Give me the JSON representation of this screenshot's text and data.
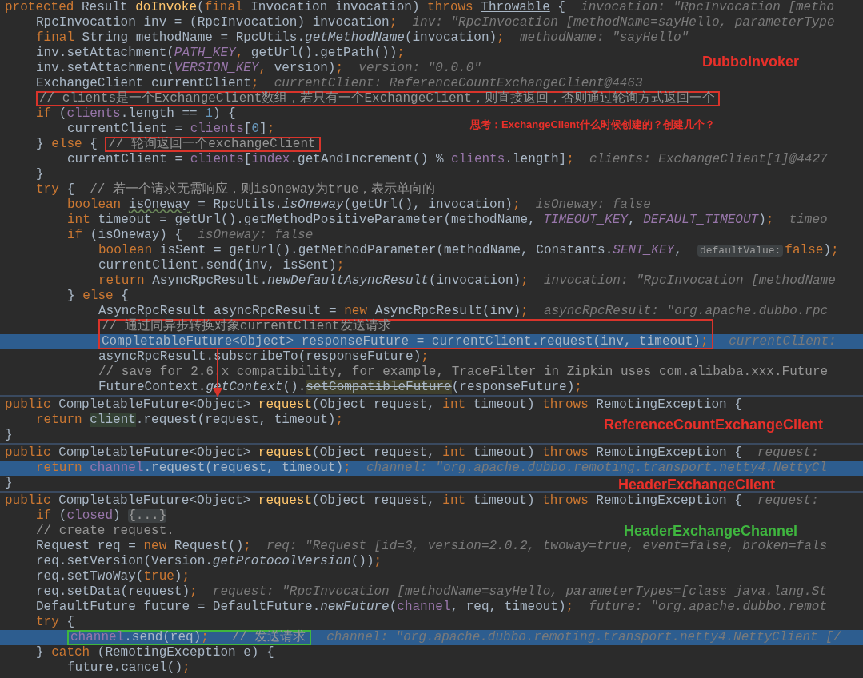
{
  "panels": [
    {
      "label": {
        "text": "DubboInvoker",
        "color": "#e8302a"
      },
      "note": {
        "text": "思考：ExchangeClient什么时候创建的？创建几个？",
        "color": "#e8302a"
      },
      "lines": [
        {
          "kind": "line",
          "highlighted": false,
          "tokens": [
            {
              "kind": "kw",
              "text": "protected "
            },
            {
              "kind": "plain",
              "text": "Result "
            },
            {
              "kind": "decl",
              "text": "doInvoke"
            },
            {
              "kind": "plain",
              "text": "("
            },
            {
              "kind": "kw",
              "text": "final "
            },
            {
              "kind": "plain",
              "text": "Invocation invocation) "
            },
            {
              "kind": "kw",
              "text": "throws "
            },
            {
              "kind": "underlined",
              "text": "Throwable"
            },
            {
              "kind": "plain",
              "text": " {  "
            },
            {
              "kind": "hint",
              "text": "invocation: \"RpcInvocation [metho"
            }
          ],
          "children": [
            {
              "kind": "line",
              "highlighted": false,
              "tokens": [
                {
                  "kind": "plain",
                  "text": "RpcInvocation inv = (RpcInvocation) invocation"
                },
                {
                  "kind": "kw",
                  "text": ";"
                },
                {
                  "kind": "hint",
                  "text": "  inv: \"RpcInvocation [methodName=sayHello, parameterType"
                }
              ]
            },
            {
              "kind": "line",
              "highlighted": false,
              "tokens": [
                {
                  "kind": "kw",
                  "text": "final "
                },
                {
                  "kind": "plain",
                  "text": "String methodName = RpcUtils."
                },
                {
                  "kind": "static",
                  "text": "getMethodName"
                },
                {
                  "kind": "plain",
                  "text": "(invocation)"
                },
                {
                  "kind": "kw",
                  "text": ";"
                },
                {
                  "kind": "hint",
                  "text": "  methodName: \"sayHello\""
                }
              ]
            },
            {
              "kind": "line",
              "highlighted": false,
              "tokens": [
                {
                  "kind": "plain",
                  "text": "inv.setAttachment("
                },
                {
                  "kind": "const",
                  "text": "PATH_KEY"
                },
                {
                  "kind": "kw",
                  "text": ", "
                },
                {
                  "kind": "plain",
                  "text": "getUrl().getPath())"
                },
                {
                  "kind": "kw",
                  "text": ";"
                }
              ]
            },
            {
              "kind": "line",
              "highlighted": false,
              "tokens": [
                {
                  "kind": "plain",
                  "text": "inv.setAttachment("
                },
                {
                  "kind": "const",
                  "text": "VERSION_KEY"
                },
                {
                  "kind": "kw",
                  "text": ", "
                },
                {
                  "kind": "plain",
                  "text": "version)"
                },
                {
                  "kind": "kw",
                  "text": ";"
                },
                {
                  "kind": "hint",
                  "text": "  version: \"0.0.0\""
                }
              ]
            },
            {
              "kind": "line",
              "highlighted": false,
              "tokens": [
                {
                  "kind": "plain",
                  "text": "ExchangeClient currentClient"
                },
                {
                  "kind": "kw",
                  "text": ";"
                },
                {
                  "kind": "hint",
                  "text": "  currentClient: ReferenceCountExchangeClient@4463"
                }
              ]
            },
            {
              "kind": "box",
              "color": "#d9342b",
              "lines": [
                {
                  "highlighted": false,
                  "inside": [
                    {
                      "kind": "comment",
                      "text": "// clients是一个ExchangeClient数组，若只有一个ExchangeClient，则直接返回，否则通过轮询方式返回一个"
                    }
                  ]
                }
              ]
            },
            {
              "kind": "line",
              "highlighted": false,
              "tokens": [
                {
                  "kind": "kw",
                  "text": "if "
                },
                {
                  "kind": "plain",
                  "text": "("
                },
                {
                  "kind": "field",
                  "text": "clients"
                },
                {
                  "kind": "plain",
                  "text": ".length == "
                },
                {
                  "kind": "num",
                  "text": "1"
                },
                {
                  "kind": "plain",
                  "text": ") {"
                }
              ],
              "children": [
                {
                  "kind": "line",
                  "highlighted": false,
                  "tokens": [
                    {
                      "kind": "plain",
                      "text": "currentClient = "
                    },
                    {
                      "kind": "field",
                      "text": "clients"
                    },
                    {
                      "kind": "plain",
                      "text": "["
                    },
                    {
                      "kind": "num",
                      "text": "0"
                    },
                    {
                      "kind": "plain",
                      "text": "]"
                    },
                    {
                      "kind": "kw",
                      "text": ";"
                    }
                  ]
                }
              ]
            },
            {
              "kind": "box",
              "color": "#d9342b",
              "lines": [
                {
                  "highlighted": false,
                  "before": [
                    {
                      "kind": "plain",
                      "text": "} "
                    },
                    {
                      "kind": "kw",
                      "text": "else "
                    },
                    {
                      "kind": "plain",
                      "text": "{ "
                    }
                  ],
                  "inside": [
                    {
                      "kind": "comment",
                      "text": "// 轮询返回一个exchangeClient"
                    }
                  ]
                }
              ],
              "children": [
                {
                  "kind": "line",
                  "highlighted": false,
                  "tokens": [
                    {
                      "kind": "plain",
                      "text": "currentClient = "
                    },
                    {
                      "kind": "field",
                      "text": "clients"
                    },
                    {
                      "kind": "plain",
                      "text": "["
                    },
                    {
                      "kind": "field",
                      "text": "index"
                    },
                    {
                      "kind": "plain",
                      "text": ".getAndIncrement() % "
                    },
                    {
                      "kind": "field",
                      "text": "clients"
                    },
                    {
                      "kind": "plain",
                      "text": ".length]"
                    },
                    {
                      "kind": "kw",
                      "text": ";"
                    },
                    {
                      "kind": "hint",
                      "text": "  clients: ExchangeClient[1]@4427"
                    }
                  ]
                }
              ]
            },
            {
              "kind": "line",
              "highlighted": false,
              "tokens": [
                {
                  "kind": "plain",
                  "text": "}"
                }
              ]
            },
            {
              "kind": "line",
              "highlighted": false,
              "tokens": [
                {
                  "kind": "kw",
                  "text": "try "
                },
                {
                  "kind": "plain",
                  "text": "{  "
                },
                {
                  "kind": "comment",
                  "text": "// 若一个请求无需响应，则isOneway为true，表示单向的"
                }
              ],
              "children": [
                {
                  "kind": "line",
                  "highlighted": false,
                  "tokens": [
                    {
                      "kind": "kw",
                      "text": "boolean "
                    },
                    {
                      "kind": "typo",
                      "text": "isOneway"
                    },
                    {
                      "kind": "plain",
                      "text": " = RpcUtils."
                    },
                    {
                      "kind": "static",
                      "text": "isOneway"
                    },
                    {
                      "kind": "plain",
                      "text": "(getUrl(), invocation)"
                    },
                    {
                      "kind": "kw",
                      "text": ";"
                    },
                    {
                      "kind": "hint",
                      "text": "  isOneway: false"
                    }
                  ]
                },
                {
                  "kind": "line",
                  "highlighted": false,
                  "tokens": [
                    {
                      "kind": "kw",
                      "text": "int "
                    },
                    {
                      "kind": "plain",
                      "text": "timeout = getUrl().getMethodPositiveParameter(methodName, "
                    },
                    {
                      "kind": "const",
                      "text": "TIMEOUT_KEY"
                    },
                    {
                      "kind": "plain",
                      "text": ", "
                    },
                    {
                      "kind": "const",
                      "text": "DEFAULT_TIMEOUT"
                    },
                    {
                      "kind": "plain",
                      "text": ")"
                    },
                    {
                      "kind": "kw",
                      "text": ";"
                    },
                    {
                      "kind": "hint",
                      "text": "  timeo"
                    }
                  ]
                },
                {
                  "kind": "line",
                  "highlighted": false,
                  "tokens": [
                    {
                      "kind": "kw",
                      "text": "if "
                    },
                    {
                      "kind": "plain",
                      "text": "(isOneway) {  "
                    },
                    {
                      "kind": "hint",
                      "text": "isOneway: false"
                    }
                  ],
                  "children": [
                    {
                      "kind": "line",
                      "highlighted": false,
                      "tokens": [
                        {
                          "kind": "kw",
                          "text": "boolean "
                        },
                        {
                          "kind": "plain",
                          "text": "isSent = getUrl().getMethodParameter(methodName, Constants."
                        },
                        {
                          "kind": "const",
                          "text": "SENT_KEY"
                        },
                        {
                          "kind": "plain",
                          "text": ",  "
                        },
                        {
                          "kind": "chip",
                          "text": "defaultValue:"
                        },
                        {
                          "kind": "kw",
                          "text": "false"
                        },
                        {
                          "kind": "plain",
                          "text": ")"
                        },
                        {
                          "kind": "kw",
                          "text": ";"
                        }
                      ]
                    },
                    {
                      "kind": "line",
                      "highlighted": false,
                      "tokens": [
                        {
                          "kind": "plain",
                          "text": "currentClient.send(inv, isSent)"
                        },
                        {
                          "kind": "kw",
                          "text": ";"
                        }
                      ]
                    },
                    {
                      "kind": "line",
                      "highlighted": false,
                      "tokens": [
                        {
                          "kind": "kw",
                          "text": "return "
                        },
                        {
                          "kind": "plain",
                          "text": "AsyncRpcResult."
                        },
                        {
                          "kind": "static",
                          "text": "newDefaultAsyncResult"
                        },
                        {
                          "kind": "plain",
                          "text": "(invocation)"
                        },
                        {
                          "kind": "kw",
                          "text": ";"
                        },
                        {
                          "kind": "hint",
                          "text": "  invocation: \"RpcInvocation [methodName"
                        }
                      ]
                    }
                  ]
                },
                {
                  "kind": "line",
                  "highlighted": false,
                  "tokens": [
                    {
                      "kind": "plain",
                      "text": "} "
                    },
                    {
                      "kind": "kw",
                      "text": "else "
                    },
                    {
                      "kind": "plain",
                      "text": "{"
                    }
                  ],
                  "children": [
                    {
                      "kind": "line",
                      "highlighted": false,
                      "tokens": [
                        {
                          "kind": "plain",
                          "text": "AsyncRpcResult asyncRpcResult = "
                        },
                        {
                          "kind": "kw",
                          "text": "new "
                        },
                        {
                          "kind": "plain",
                          "text": "AsyncRpcResult(inv)"
                        },
                        {
                          "kind": "kw",
                          "text": ";"
                        },
                        {
                          "kind": "hint",
                          "text": "  asyncRpcResult: \"org.apache.dubbo.rpc"
                        }
                      ]
                    },
                    {
                      "kind": "box",
                      "color": "#d9342b",
                      "lines": [
                        {
                          "highlighted": false,
                          "inside": [
                            {
                              "kind": "comment",
                              "text": "// 通过同异步转换对象currentClient发送请求"
                            }
                          ]
                        },
                        {
                          "highlighted": true,
                          "inside": [
                            {
                              "kind": "plain",
                              "text": "CompletableFuture<Object> responseFuture = currentClient.request(inv, timeout)"
                            },
                            {
                              "kind": "kw",
                              "text": ";"
                            }
                          ],
                          "after": [
                            {
                              "kind": "hint",
                              "text": "  currentClient:"
                            }
                          ]
                        }
                      ]
                    },
                    {
                      "kind": "line",
                      "highlighted": false,
                      "tokens": [
                        {
                          "kind": "plain",
                          "text": "asyncRpcResult.subscribeTo(responseFuture)"
                        },
                        {
                          "kind": "kw",
                          "text": ";"
                        }
                      ]
                    },
                    {
                      "kind": "line",
                      "highlighted": false,
                      "tokens": [
                        {
                          "kind": "comment",
                          "text": "// save for 2.6.x compatibility, for example, TraceFilter in Zipkin uses com.alibaba.xxx.Future"
                        }
                      ]
                    },
                    {
                      "kind": "line",
                      "highlighted": false,
                      "tokens": [
                        {
                          "kind": "plain",
                          "text": "FutureContext."
                        },
                        {
                          "kind": "static",
                          "text": "getContext"
                        },
                        {
                          "kind": "plain",
                          "text": "()."
                        },
                        {
                          "kind": "deprecated",
                          "text": "setCompatibleFuture"
                        },
                        {
                          "kind": "plain",
                          "text": "(responseFuture)"
                        },
                        {
                          "kind": "kw",
                          "text": ";"
                        }
                      ]
                    }
                  ]
                }
              ]
            }
          ]
        }
      ]
    },
    {
      "label": {
        "text": "ReferenceCountExchangeClient",
        "color": "#e8302a"
      },
      "lines": [
        {
          "kind": "line",
          "highlighted": false,
          "tokens": [
            {
              "kind": "kw",
              "text": "public "
            },
            {
              "kind": "plain",
              "text": "CompletableFuture<Object> "
            },
            {
              "kind": "decl",
              "text": "request"
            },
            {
              "kind": "plain",
              "text": "(Object request, "
            },
            {
              "kind": "kw",
              "text": "int "
            },
            {
              "kind": "plain",
              "text": "timeout) "
            },
            {
              "kind": "kw",
              "text": "throws "
            },
            {
              "kind": "plain",
              "text": "RemotingException {"
            }
          ],
          "children": [
            {
              "kind": "line",
              "highlighted": false,
              "tokens": [
                {
                  "kind": "kw",
                  "text": "return "
                },
                {
                  "kind": "usage",
                  "text": "client"
                },
                {
                  "kind": "plain",
                  "text": ".request(request, timeout)"
                },
                {
                  "kind": "kw",
                  "text": ";"
                }
              ]
            }
          ]
        },
        {
          "kind": "line",
          "highlighted": false,
          "tokens": [
            {
              "kind": "plain",
              "text": "}"
            }
          ]
        }
      ]
    },
    {
      "label": {
        "text": "HeaderExchangeClient",
        "color": "#e8302a"
      },
      "lines": [
        {
          "kind": "line",
          "highlighted": false,
          "tokens": [
            {
              "kind": "kw",
              "text": "public "
            },
            {
              "kind": "plain",
              "text": "CompletableFuture<Object> "
            },
            {
              "kind": "decl",
              "text": "request"
            },
            {
              "kind": "plain",
              "text": "(Object request, "
            },
            {
              "kind": "kw",
              "text": "int "
            },
            {
              "kind": "plain",
              "text": "timeout) "
            },
            {
              "kind": "kw",
              "text": "throws "
            },
            {
              "kind": "plain",
              "text": "RemotingException {"
            },
            {
              "kind": "hint",
              "text": "  request:"
            }
          ],
          "children": [
            {
              "kind": "line",
              "highlighted": true,
              "tokens": [
                {
                  "kind": "kw",
                  "text": "return "
                },
                {
                  "kind": "field",
                  "text": "channel"
                },
                {
                  "kind": "plain",
                  "text": ".request(request, timeout)"
                },
                {
                  "kind": "kw",
                  "text": ";"
                },
                {
                  "kind": "hint",
                  "text": "  channel: \"org.apache.dubbo.remoting.transport.netty4.NettyCl"
                }
              ]
            }
          ]
        },
        {
          "kind": "line",
          "highlighted": false,
          "tokens": [
            {
              "kind": "plain",
              "text": "}"
            }
          ]
        }
      ]
    },
    {
      "label": {
        "text": "HeaderExchangeChannel",
        "color": "#3fb63f"
      },
      "lines": [
        {
          "kind": "line",
          "highlighted": false,
          "tokens": [
            {
              "kind": "kw",
              "text": "public "
            },
            {
              "kind": "plain",
              "text": "CompletableFuture<Object> "
            },
            {
              "kind": "decl",
              "text": "request"
            },
            {
              "kind": "plain",
              "text": "(Object request, "
            },
            {
              "kind": "kw",
              "text": "int "
            },
            {
              "kind": "plain",
              "text": "timeout) "
            },
            {
              "kind": "kw",
              "text": "throws "
            },
            {
              "kind": "plain",
              "text": "RemotingException {"
            },
            {
              "kind": "hint",
              "text": "  request:"
            }
          ],
          "children": [
            {
              "kind": "line",
              "highlighted": false,
              "tokens": [
                {
                  "kind": "kw",
                  "text": "if "
                },
                {
                  "kind": "plain",
                  "text": "("
                },
                {
                  "kind": "field",
                  "text": "closed"
                },
                {
                  "kind": "plain",
                  "text": ") "
                },
                {
                  "kind": "fold",
                  "text": "{...}"
                }
              ]
            },
            {
              "kind": "line",
              "highlighted": false,
              "tokens": [
                {
                  "kind": "comment",
                  "text": "// create request."
                }
              ]
            },
            {
              "kind": "line",
              "highlighted": false,
              "tokens": [
                {
                  "kind": "plain",
                  "text": "Request req = "
                },
                {
                  "kind": "kw",
                  "text": "new "
                },
                {
                  "kind": "plain",
                  "text": "Request()"
                },
                {
                  "kind": "kw",
                  "text": ";"
                },
                {
                  "kind": "hint",
                  "text": "  req: \"Request [id=3, version=2.0.2, twoway=true, event=false, broken=fals"
                }
              ]
            },
            {
              "kind": "line",
              "highlighted": false,
              "tokens": [
                {
                  "kind": "plain",
                  "text": "req.setVersion(Version."
                },
                {
                  "kind": "static",
                  "text": "getProtocolVersion"
                },
                {
                  "kind": "plain",
                  "text": "())"
                },
                {
                  "kind": "kw",
                  "text": ";"
                }
              ]
            },
            {
              "kind": "line",
              "highlighted": false,
              "tokens": [
                {
                  "kind": "plain",
                  "text": "req.setTwoWay("
                },
                {
                  "kind": "kw",
                  "text": "true"
                },
                {
                  "kind": "plain",
                  "text": ")"
                },
                {
                  "kind": "kw",
                  "text": ";"
                }
              ]
            },
            {
              "kind": "line",
              "highlighted": false,
              "tokens": [
                {
                  "kind": "plain",
                  "text": "req.setData(request)"
                },
                {
                  "kind": "kw",
                  "text": ";"
                },
                {
                  "kind": "hint",
                  "text": "  request: \"RpcInvocation [methodName=sayHello, parameterTypes=[class java.lang.St"
                }
              ]
            },
            {
              "kind": "line",
              "highlighted": false,
              "tokens": [
                {
                  "kind": "plain",
                  "text": "DefaultFuture future = DefaultFuture."
                },
                {
                  "kind": "static",
                  "text": "newFuture"
                },
                {
                  "kind": "plain",
                  "text": "("
                },
                {
                  "kind": "field",
                  "text": "channel"
                },
                {
                  "kind": "plain",
                  "text": ", req, timeout)"
                },
                {
                  "kind": "kw",
                  "text": ";"
                },
                {
                  "kind": "hint",
                  "text": "  future: \"org.apache.dubbo.remot"
                }
              ]
            },
            {
              "kind": "line",
              "highlighted": false,
              "tokens": [
                {
                  "kind": "kw",
                  "text": "try "
                },
                {
                  "kind": "plain",
                  "text": "{"
                }
              ],
              "children": [
                {
                  "kind": "box",
                  "color": "#3fb63f",
                  "lines": [
                    {
                      "highlighted": true,
                      "inside": [
                        {
                          "kind": "field",
                          "text": "channel"
                        },
                        {
                          "kind": "plain",
                          "text": ".send(req)"
                        },
                        {
                          "kind": "kw",
                          "text": ";"
                        },
                        {
                          "kind": "comment",
                          "text": "   // 发送请求"
                        }
                      ],
                      "after": [
                        {
                          "kind": "hint",
                          "text": "  channel: \"org.apache.dubbo.remoting.transport.netty4.NettyClient [/"
                        }
                      ]
                    }
                  ]
                }
              ]
            },
            {
              "kind": "line",
              "highlighted": false,
              "tokens": [
                {
                  "kind": "plain",
                  "text": "} "
                },
                {
                  "kind": "kw",
                  "text": "catch "
                },
                {
                  "kind": "plain",
                  "text": "(RemotingException e) {"
                }
              ],
              "children": [
                {
                  "kind": "line",
                  "highlighted": false,
                  "tokens": [
                    {
                      "kind": "plain",
                      "text": "future.cancel()"
                    },
                    {
                      "kind": "kw",
                      "text": ";"
                    }
                  ]
                }
              ]
            }
          ]
        }
      ]
    }
  ]
}
